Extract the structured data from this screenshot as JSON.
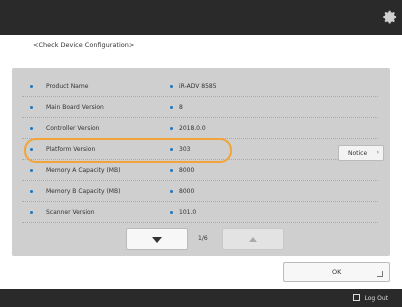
{
  "header": {
    "gear_icon": "gear-icon"
  },
  "screen_title": "<Check Device Configuration>",
  "rows": [
    {
      "label": "Product Name",
      "value": "iR-ADV 8585"
    },
    {
      "label": "Main Board Version",
      "value": "8"
    },
    {
      "label": "Controller Version",
      "value": "2018.0.0"
    },
    {
      "label": "Platform Version",
      "value": "303"
    },
    {
      "label": "Memory A Capacity (MB)",
      "value": "8000"
    },
    {
      "label": "Memory B Capacity (MB)",
      "value": "8000"
    },
    {
      "label": "Scanner Version",
      "value": "101.0"
    }
  ],
  "notice_button": {
    "label": "Notice",
    "icon": "chevron-right-icon"
  },
  "pager": {
    "page_indicator": "1/6"
  },
  "ok_button": {
    "label": "OK"
  },
  "footer": {
    "logout_label": "Log Out",
    "logout_icon": "logout-icon"
  },
  "colors": {
    "header_bg": "#2a2a2a",
    "panel_bg": "#cfcfcf",
    "highlight": "#f2a43a",
    "bullet": "#1c78c2"
  }
}
